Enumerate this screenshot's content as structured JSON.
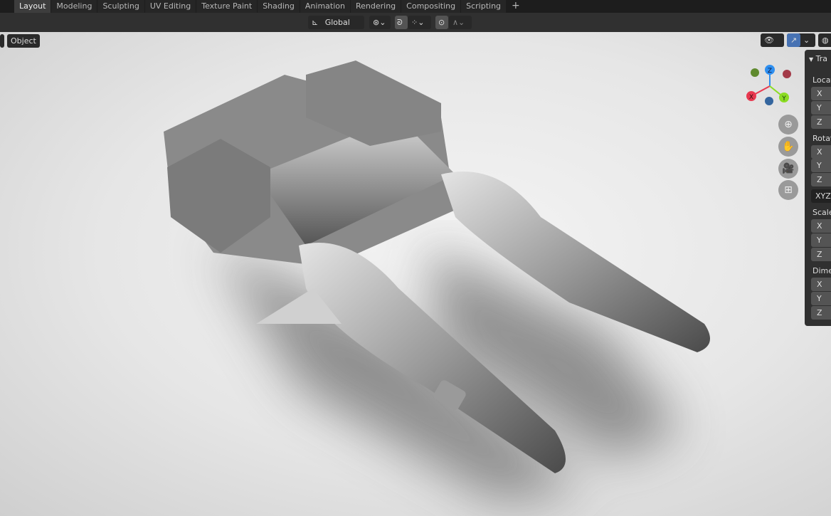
{
  "workspace_tabs": [
    {
      "label": "Layout",
      "active": true
    },
    {
      "label": "Modeling"
    },
    {
      "label": "Sculpting"
    },
    {
      "label": "UV Editing"
    },
    {
      "label": "Texture Paint"
    },
    {
      "label": "Shading"
    },
    {
      "label": "Animation"
    },
    {
      "label": "Rendering"
    },
    {
      "label": "Compositing"
    },
    {
      "label": "Scripting"
    },
    {
      "label": "+"
    }
  ],
  "header": {
    "orientation": "Global",
    "orientation_icon": "transform-orientation-icon",
    "pivot_icon": "pivot-point-icon",
    "snap_icon": "magnet-icon",
    "snap_target_icon": "snap-grid-icon",
    "proportional_icon": "proportional-edit-icon",
    "falloff_icon": "falloff-curve-icon"
  },
  "viewport": {
    "mode": "Object",
    "visibility_icon": "eye-icon",
    "gizmo_icon": "gizmo-icon",
    "shading_icon": "sphere-shading-icon"
  },
  "nav_gizmo": {
    "axes": [
      "X",
      "Y",
      "Z"
    ],
    "colors": {
      "x": "#e8384f",
      "y": "#8bdc23",
      "z": "#2e8ff0"
    }
  },
  "nav_buttons": [
    "zoom-icon",
    "hand-pan-icon",
    "camera-icon",
    "grid-perspective-icon"
  ],
  "n_panel": {
    "header": "Tra",
    "sections": [
      {
        "label": "Locat",
        "fields": [
          "X",
          "Y",
          "Z"
        ]
      },
      {
        "label": "Rotat",
        "fields": [
          "X",
          "Y",
          "Z"
        ],
        "mode": "XYZ"
      },
      {
        "label": "Scale",
        "fields": [
          "X",
          "Y",
          "Z"
        ]
      },
      {
        "label": "Dime",
        "fields": [
          "X",
          "Y",
          "Z"
        ]
      }
    ]
  }
}
